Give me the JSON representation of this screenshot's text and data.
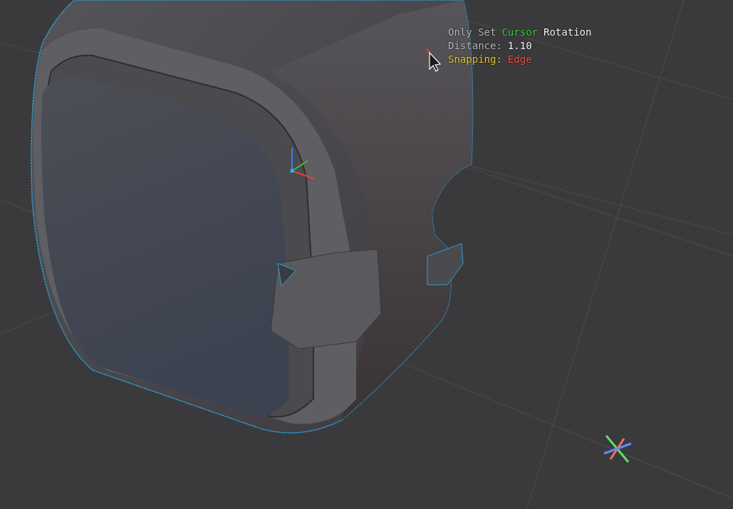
{
  "viewport": {
    "overlay": [
      {
        "segments": [
          {
            "text": "Only Set",
            "kind": "label"
          },
          {
            "text": "Cursor",
            "kind": "accent"
          },
          {
            "text": "Rotation",
            "kind": "value"
          }
        ]
      },
      {
        "segments": [
          {
            "text": "Distance:",
            "kind": "label"
          },
          {
            "text": "1.10",
            "kind": "value"
          }
        ]
      },
      {
        "segments": [
          {
            "text": "Snapping:",
            "kind": "warning"
          },
          {
            "text": "Edge",
            "kind": "alert"
          }
        ]
      }
    ]
  }
}
